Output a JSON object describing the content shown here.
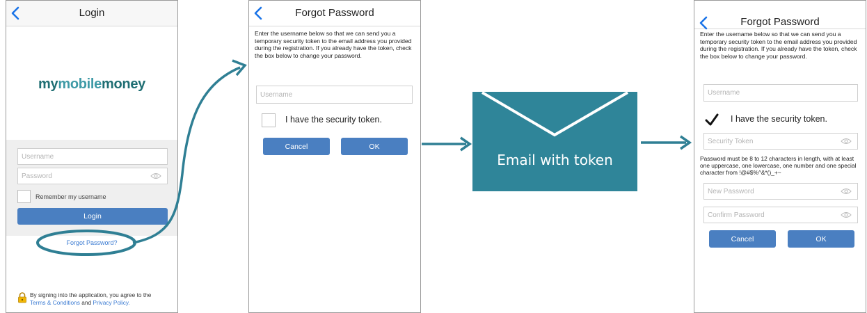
{
  "colors": {
    "accent": "#2f8599",
    "button": "#4a7fc1",
    "link": "#3b7bd2"
  },
  "login_screen": {
    "title": "Login",
    "logo_part1": "my",
    "logo_part2": "mobile",
    "logo_part3": "money",
    "username_placeholder": "Username",
    "password_placeholder": "Password",
    "remember_label": "Remember my username",
    "login_button": "Login",
    "forgot_link": "Forgot Password?",
    "footer_text": "By signing into the application, you agree to the",
    "terms_link": "Terms & Conditions",
    "and_text": "and",
    "privacy_link": "Privacy Policy."
  },
  "forgot_screen": {
    "title": "Forgot Password",
    "description": "Enter the username below so that we can send you a temporary security token to the email address you provided during the registration. If you already have the token, check the box below to change your password.",
    "username_placeholder": "Username",
    "token_checkbox_label": "I have the security token.",
    "cancel_button": "Cancel",
    "ok_button": "OK"
  },
  "email_step": {
    "label": "Email with token",
    "icon": "envelope-icon"
  },
  "reset_screen": {
    "title": "Forgot Password",
    "description": "Enter the username below so that we can send you a temporary security token to the email address you provided during the registration. If you already have the token, check the box below to change your password.",
    "username_placeholder": "Username",
    "token_checkbox_label": "I have the security token.",
    "token_checkbox_checked": true,
    "security_token_placeholder": "Security Token",
    "password_rule": "Password must be 8 to 12 characters in length, with at least one uppercase, one lowercase, one number and one special character from !@#$%^&*()_+~",
    "new_password_placeholder": "New Password",
    "confirm_password_placeholder": "Confirm Password",
    "cancel_button": "Cancel",
    "ok_button": "OK"
  }
}
